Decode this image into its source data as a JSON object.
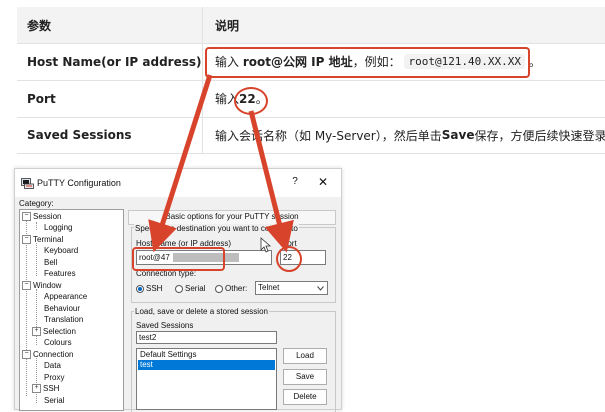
{
  "table": {
    "headers": [
      "参数",
      "说明"
    ],
    "rows": [
      {
        "param": "Host Name(or IP address)",
        "desc_pre": "输入 ",
        "desc_bold": "root@公网 IP 地址",
        "desc_mid": "，例如：",
        "desc_code": "root@121.40.XX.XX",
        "desc_post": "。"
      },
      {
        "param": "Port",
        "desc_pre": "输入 ",
        "desc_bold": "22",
        "desc_post": "。"
      },
      {
        "param": "Saved Sessions",
        "desc_pre": "输入会话名称（如 My-Server），然后单击 ",
        "desc_bold": "Save",
        "desc_post": " 保存，方便后续快速登录。"
      }
    ]
  },
  "putty": {
    "title": "PuTTY Configuration",
    "help": "?",
    "close": "✕",
    "category_label": "Category:",
    "tree": [
      "Session",
      "Logging",
      "Terminal",
      "Keyboard",
      "Bell",
      "Features",
      "Window",
      "Appearance",
      "Behaviour",
      "Translation",
      "Selection",
      "Colours",
      "Connection",
      "Data",
      "Proxy",
      "SSH",
      "Serial"
    ],
    "group_title": "Basic options for your PuTTY session",
    "dest_label": "Specify the destination you want to connect to",
    "host_label": "Host Name (or IP address)",
    "port_label": "Port",
    "host_value": "root@47",
    "port_value": "22",
    "conn_type_label": "Connection type:",
    "conn_types": [
      "SSH",
      "Serial",
      "Other:"
    ],
    "other_value": "Telnet",
    "load_save_label": "Load, save or delete a stored session",
    "saved_sessions_label": "Saved Sessions",
    "session_name": "test2",
    "sessions": [
      "Default Settings",
      "test"
    ],
    "buttons": {
      "load": "Load",
      "save": "Save",
      "delete": "Delete"
    }
  },
  "colors": {
    "accent_red": "#d8432b",
    "selection_blue": "#0078d7"
  },
  "icons": [
    "putty-app-icon",
    "help-icon",
    "close-icon",
    "dropdown-arrow-icon",
    "mouse-cursor-icon"
  ]
}
